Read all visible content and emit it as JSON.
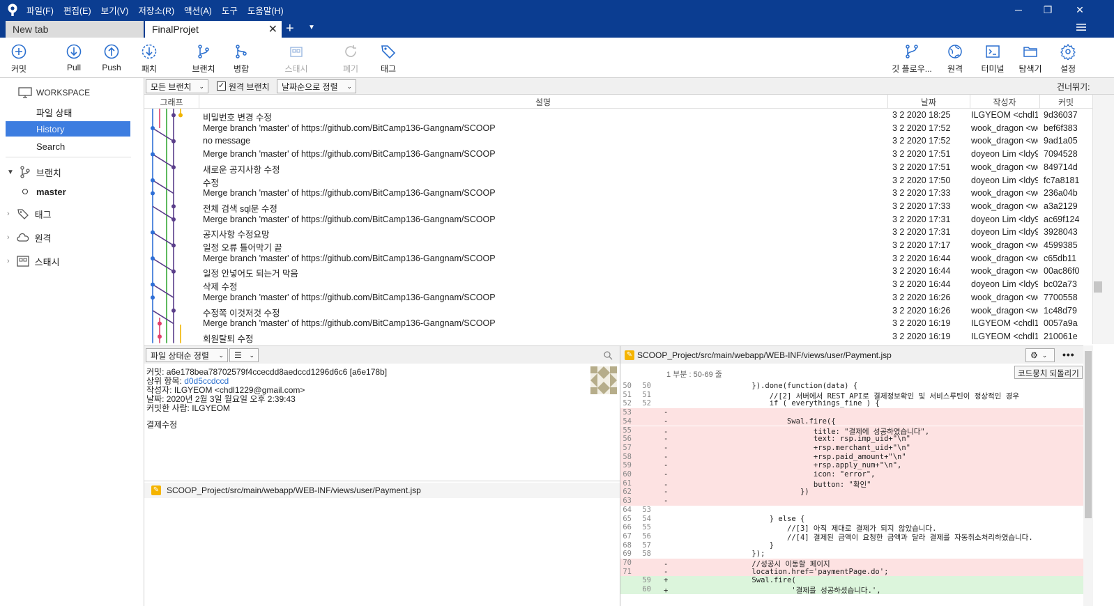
{
  "app": {
    "menu": [
      "파일(F)",
      "편집(E)",
      "보기(V)",
      "저장소(R)",
      "액션(A)",
      "도구",
      "도움말(H)"
    ]
  },
  "tabs": [
    {
      "label": "New tab",
      "active": false
    },
    {
      "label": "FinalProjet",
      "active": true
    }
  ],
  "toolbar": {
    "left": [
      {
        "label": "커밋",
        "icon": "plus-circle-icon",
        "disabled": false
      },
      {
        "label": "Pull",
        "icon": "pull-icon",
        "disabled": false
      },
      {
        "label": "Push",
        "icon": "push-icon",
        "disabled": false
      },
      {
        "label": "패치",
        "icon": "fetch-icon",
        "disabled": false
      },
      {
        "label": "브랜치",
        "icon": "branch-icon",
        "disabled": false
      },
      {
        "label": "병합",
        "icon": "merge-icon",
        "disabled": false
      },
      {
        "label": "스태시",
        "icon": "stash-icon",
        "disabled": true
      },
      {
        "label": "폐기",
        "icon": "discard-icon",
        "disabled": true
      },
      {
        "label": "태그",
        "icon": "tag-icon",
        "disabled": false
      }
    ],
    "right": [
      {
        "label": "깃 플로우...",
        "icon": "git-flow-icon"
      },
      {
        "label": "원격",
        "icon": "globe-icon"
      },
      {
        "label": "터미널",
        "icon": "terminal-icon"
      },
      {
        "label": "탐색기",
        "icon": "folder-icon"
      },
      {
        "label": "설정",
        "icon": "gear-icon"
      }
    ]
  },
  "sidebar": {
    "workspace": "WORKSPACE",
    "items": [
      "파일 상태",
      "History",
      "Search"
    ],
    "active": "History",
    "sections": [
      {
        "label": "브랜치",
        "expanded": true,
        "children": [
          "master"
        ]
      },
      {
        "label": "태그",
        "expanded": false
      },
      {
        "label": "원격",
        "expanded": false
      },
      {
        "label": "스태시",
        "expanded": false
      }
    ]
  },
  "filter": {
    "branches": "모든 브랜치",
    "remote_branches": "원격 브랜치",
    "remote_checked": true,
    "sort": "날짜순으로 정렬",
    "skip": "건너뛰기:"
  },
  "history": {
    "columns": [
      "그래프",
      "설명",
      "날짜",
      "작성자",
      "커밋"
    ],
    "rows": [
      {
        "desc": "비밀번호 변경 수정",
        "date": "3 2 2020 18:25",
        "author": "ILGYEOM <chdl12",
        "commit": "9d36037"
      },
      {
        "desc": "Merge branch 'master' of https://github.com/BitCamp136-Gangnam/SCOOP",
        "date": "3 2 2020 17:52",
        "author": "wook_dragon <wc",
        "commit": "bef6f383"
      },
      {
        "desc": "no message",
        "date": "3 2 2020 17:52",
        "author": "wook_dragon <wc",
        "commit": "9ad1a05"
      },
      {
        "desc": "Merge branch 'master' of https://github.com/BitCamp136-Gangnam/SCOOP",
        "date": "3 2 2020 17:51",
        "author": "doyeon Lim <ldy9",
        "commit": "7094528"
      },
      {
        "desc": "새로운 공지사항 수정",
        "date": "3 2 2020 17:51",
        "author": "wook_dragon <wc",
        "commit": "849714d"
      },
      {
        "desc": "수정",
        "date": "3 2 2020 17:50",
        "author": "doyeon Lim <ldy9",
        "commit": "fc7a8181"
      },
      {
        "desc": "Merge branch 'master' of https://github.com/BitCamp136-Gangnam/SCOOP",
        "date": "3 2 2020 17:33",
        "author": "wook_dragon <wc",
        "commit": "236a04b"
      },
      {
        "desc": "전체 검색 sql문 수정",
        "date": "3 2 2020 17:33",
        "author": "wook_dragon <wc",
        "commit": "a3a2129"
      },
      {
        "desc": "Merge branch 'master' of https://github.com/BitCamp136-Gangnam/SCOOP",
        "date": "3 2 2020 17:31",
        "author": "doyeon Lim <ldy9",
        "commit": "ac69f124"
      },
      {
        "desc": "공지사항 수정요망",
        "date": "3 2 2020 17:31",
        "author": "doyeon Lim <ldy9",
        "commit": "3928043"
      },
      {
        "desc": "일정 오류 틀어막기 끝",
        "date": "3 2 2020 17:17",
        "author": "wook_dragon <wc",
        "commit": "4599385"
      },
      {
        "desc": "Merge branch 'master' of https://github.com/BitCamp136-Gangnam/SCOOP",
        "date": "3 2 2020 16:44",
        "author": "wook_dragon <wc",
        "commit": "c65db11"
      },
      {
        "desc": "일정 안넣어도 되는거 막음",
        "date": "3 2 2020 16:44",
        "author": "wook_dragon <wc",
        "commit": "00ac86f0"
      },
      {
        "desc": "삭제 수정",
        "date": "3 2 2020 16:44",
        "author": "doyeon Lim <ldy9",
        "commit": "bc02a73"
      },
      {
        "desc": "Merge branch 'master' of https://github.com/BitCamp136-Gangnam/SCOOP",
        "date": "3 2 2020 16:26",
        "author": "wook_dragon <wc",
        "commit": "7700558"
      },
      {
        "desc": "수정쪽 이것저것 수정",
        "date": "3 2 2020 16:26",
        "author": "wook_dragon <wc",
        "commit": "1c48d79"
      },
      {
        "desc": "Merge branch 'master' of https://github.com/BitCamp136-Gangnam/SCOOP",
        "date": "3 2 2020 16:19",
        "author": "ILGYEOM <chdl12",
        "commit": "0057a9a"
      },
      {
        "desc": "회원탈퇴 수정",
        "date": "3 2 2020 16:19",
        "author": "ILGYEOM <chdl12",
        "commit": "210061e"
      }
    ]
  },
  "details": {
    "sort_label": "파일 상태순 정렬",
    "commit_label": "커밋:",
    "commit_value": "a6e178bea78702579f4ccecdd8aedccd1296d6c6 [a6e178b]",
    "parent_label": "상위 항목:",
    "parent_value": "d0d5ccdccd",
    "author_label": "작성자:",
    "author_value": "ILGYEOM <chdl1229@gmail.com>",
    "date_label": "날짜:",
    "date_value": "2020년 2월 3일 월요일 오후 2:39:43",
    "committer_label": "커밋한 사람:",
    "committer_value": "ILGYEOM",
    "message": "결제수정",
    "files": [
      "SCOOP_Project/src/main/webapp/WEB-INF/views/user/Payment.jsp"
    ]
  },
  "diff": {
    "file": "SCOOP_Project/src/main/webapp/WEB-INF/views/user/Payment.jsp",
    "hunk": "1 부분 : 50-69 줄",
    "revert": "코드뭉치 되돌리기",
    "lines": [
      {
        "o": "50",
        "n": "50",
        "t": "ctx",
        "c": "                    }).done(function(data) {"
      },
      {
        "o": "51",
        "n": "51",
        "t": "ctx",
        "c": "                        //[2] 서버에서 REST API로 결제정보확인 및 서비스루틴이 정상적인 경우"
      },
      {
        "o": "52",
        "n": "52",
        "t": "ctx",
        "c": "                        if ( everythings_fine ) {"
      },
      {
        "o": "53",
        "n": "",
        "t": "del",
        "c": "-"
      },
      {
        "o": "54",
        "n": "",
        "t": "del",
        "c": "-                           Swal.fire({"
      },
      {
        "o": "55",
        "n": "",
        "t": "del",
        "c": "-                                 title: \"결제에 성공하였습니다\","
      },
      {
        "o": "56",
        "n": "",
        "t": "del",
        "c": "-                                 text: rsp.imp_uid+\"\\n\""
      },
      {
        "o": "57",
        "n": "",
        "t": "del",
        "c": "-                                 +rsp.merchant_uid+\"\\n\""
      },
      {
        "o": "58",
        "n": "",
        "t": "del",
        "c": "-                                 +rsp.paid_amount+\"\\n\""
      },
      {
        "o": "59",
        "n": "",
        "t": "del",
        "c": "-                                 +rsp.apply_num+\"\\n\","
      },
      {
        "o": "60",
        "n": "",
        "t": "del",
        "c": "-                                 icon: \"error\","
      },
      {
        "o": "61",
        "n": "",
        "t": "del",
        "c": "-                                 button: \"확인\""
      },
      {
        "o": "62",
        "n": "",
        "t": "del",
        "c": "-                              })"
      },
      {
        "o": "63",
        "n": "",
        "t": "del",
        "c": "-"
      },
      {
        "o": "64",
        "n": "53",
        "t": "ctx",
        "c": ""
      },
      {
        "o": "65",
        "n": "54",
        "t": "ctx",
        "c": "                        } else {"
      },
      {
        "o": "66",
        "n": "55",
        "t": "ctx",
        "c": "                            //[3] 아직 제대로 결제가 되지 않았습니다."
      },
      {
        "o": "67",
        "n": "56",
        "t": "ctx",
        "c": "                            //[4] 결제된 금액이 요청한 금액과 달라 결제를 자동취소처리하였습니다."
      },
      {
        "o": "68",
        "n": "57",
        "t": "ctx",
        "c": "                        }"
      },
      {
        "o": "69",
        "n": "58",
        "t": "ctx",
        "c": "                    });"
      },
      {
        "o": "70",
        "n": "",
        "t": "del",
        "c": "-                   //성공시 이동할 페이지"
      },
      {
        "o": "71",
        "n": "",
        "t": "del",
        "c": "-                   location.href='paymentPage.do';"
      },
      {
        "o": "",
        "n": "59",
        "t": "add",
        "c": "+                   Swal.fire("
      },
      {
        "o": "",
        "n": "60",
        "t": "add",
        "c": "+                            '결제를 성공하셨습니다.',"
      }
    ]
  }
}
